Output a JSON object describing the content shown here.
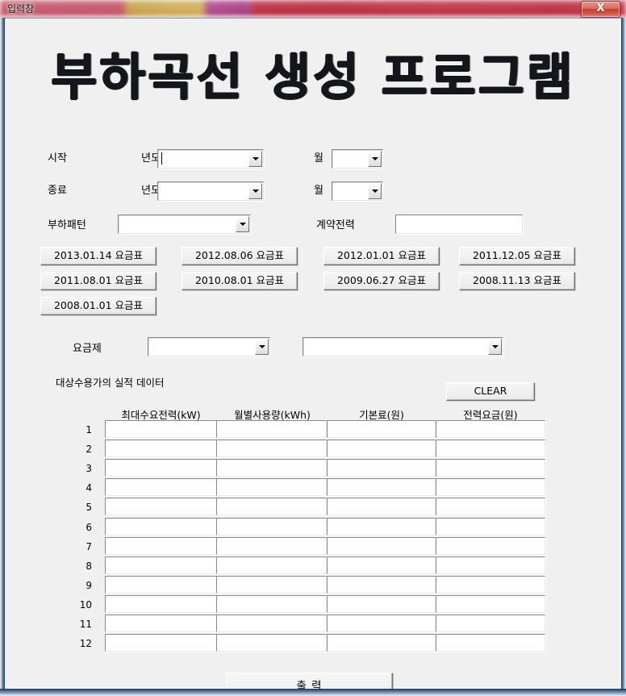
{
  "window": {
    "title": "입력창",
    "close_label": "X"
  },
  "app": {
    "heading": "부하곡선 생성 프로그램"
  },
  "form": {
    "start_label": "시작",
    "end_label": "종료",
    "year_label_start": "년도",
    "year_label_end": "년도",
    "month_label_start": "월",
    "month_label_end": "월",
    "start_year_value": "",
    "start_month_value": "",
    "end_year_value": "",
    "end_month_value": "",
    "load_pattern_label": "부하패턴",
    "load_pattern_value": "",
    "contract_power_label": "계약전력",
    "contract_power_value": "",
    "contract_power_placeholder": ""
  },
  "tariff_buttons": [
    {
      "label": "2013.01.14 요금표"
    },
    {
      "label": "2012.08.06 요금표"
    },
    {
      "label": "2012.01.01 요금표"
    },
    {
      "label": "2011.12.05 요금표"
    },
    {
      "label": "2011.08.01 요금표"
    },
    {
      "label": "2010.08.01 요금표"
    },
    {
      "label": "2009.06.27 요금표"
    },
    {
      "label": "2008.11.13 요금표"
    },
    {
      "label": "2008.01.01 요금표"
    }
  ],
  "rate_plan": {
    "label": "요금제",
    "plan_value": "",
    "detail_value": ""
  },
  "data_section": {
    "title": "대상수용가의 실적 데이터",
    "clear_label": "CLEAR",
    "columns": [
      "최대수요전력(kW)",
      "월별사용량(kWh)",
      "기본료(원)",
      "전력요금(원)"
    ],
    "rows": [
      {
        "no": "1",
        "cells": [
          "",
          "",
          "",
          ""
        ]
      },
      {
        "no": "2",
        "cells": [
          "",
          "",
          "",
          ""
        ]
      },
      {
        "no": "3",
        "cells": [
          "",
          "",
          "",
          ""
        ]
      },
      {
        "no": "4",
        "cells": [
          "",
          "",
          "",
          ""
        ]
      },
      {
        "no": "5",
        "cells": [
          "",
          "",
          "",
          ""
        ]
      },
      {
        "no": "6",
        "cells": [
          "",
          "",
          "",
          ""
        ]
      },
      {
        "no": "7",
        "cells": [
          "",
          "",
          "",
          ""
        ]
      },
      {
        "no": "8",
        "cells": [
          "",
          "",
          "",
          ""
        ]
      },
      {
        "no": "9",
        "cells": [
          "",
          "",
          "",
          ""
        ]
      },
      {
        "no": "10",
        "cells": [
          "",
          "",
          "",
          ""
        ]
      },
      {
        "no": "11",
        "cells": [
          "",
          "",
          "",
          ""
        ]
      },
      {
        "no": "12",
        "cells": [
          "",
          "",
          "",
          ""
        ]
      }
    ]
  },
  "footer": {
    "print_label": "출     력"
  },
  "colors": {
    "client_bg": "#f0f0f0",
    "titlebar_accent_red": "#c02f45",
    "titlebar_accent_gold": "#cfae55",
    "titlebar_accent_purple": "#a83f84",
    "close_button": "#c63e32",
    "text": "#000000"
  }
}
